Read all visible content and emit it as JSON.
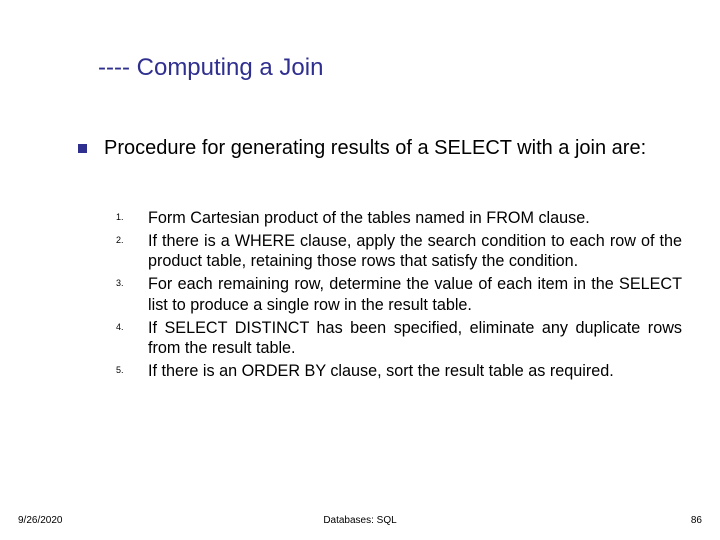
{
  "title": "---- Computing a Join",
  "intro": "Procedure for generating results of a SELECT with a join are:",
  "items": [
    {
      "n": "1.",
      "t": "Form Cartesian product of the tables named in  FROM clause."
    },
    {
      "n": "2.",
      "t": "If there is a WHERE clause, apply the search condition to each row of the product table, retaining those rows that satisfy the condition."
    },
    {
      "n": "3.",
      "t": "For each remaining row, determine the value of each item in the SELECT list to produce a single row in the result table."
    },
    {
      "n": "4.",
      "t": "If SELECT DISTINCT has been specified, eliminate any duplicate rows from the result table."
    },
    {
      "n": "5.",
      "t": "If there is an ORDER BY clause, sort the result table as required."
    }
  ],
  "footer": {
    "left": "9/26/2020",
    "center": "Databases: SQL",
    "right": "86"
  }
}
